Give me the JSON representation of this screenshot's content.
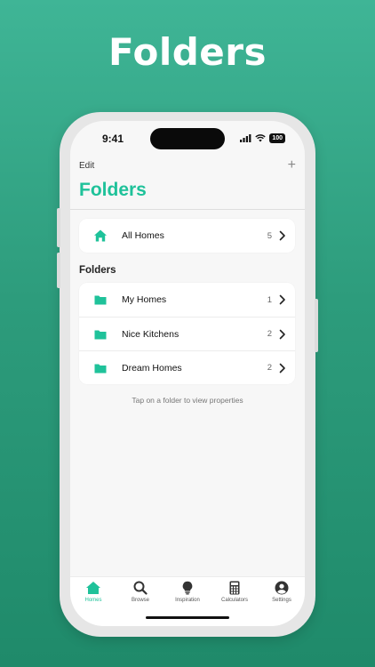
{
  "hero_title": "Folders",
  "status_bar": {
    "time": "9:41",
    "battery": "100"
  },
  "nav": {
    "edit_label": "Edit",
    "add_symbol": "+"
  },
  "page_title": "Folders",
  "all_homes": {
    "label": "All Homes",
    "count": "5",
    "icon": "home-icon"
  },
  "folders_section": {
    "header": "Folders",
    "items": [
      {
        "label": "My Homes",
        "count": "1",
        "icon": "folder-icon"
      },
      {
        "label": "Nice Kitchens",
        "count": "2",
        "icon": "folder-icon"
      },
      {
        "label": "Dream Homes",
        "count": "2",
        "icon": "folder-icon"
      }
    ]
  },
  "hint": "Tap on a folder to view properties",
  "tab_bar": {
    "items": [
      {
        "label": "Homes",
        "icon": "home-icon",
        "active": true
      },
      {
        "label": "Browse",
        "icon": "search-icon"
      },
      {
        "label": "Inspiration",
        "icon": "lightbulb-icon"
      },
      {
        "label": "Calculators",
        "icon": "calculator-icon"
      },
      {
        "label": "Settings",
        "icon": "user-circle-icon"
      }
    ]
  },
  "colors": {
    "accent": "#1fc29a",
    "background_top": "#3fb596",
    "background_bottom": "#1f8a6a"
  }
}
